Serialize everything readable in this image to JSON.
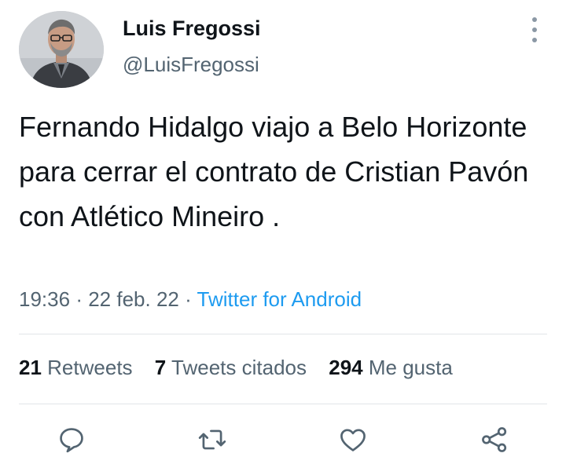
{
  "tweet": {
    "author_name": "Luis Fregossi",
    "author_handle": "@LuisFregossi",
    "text": "Fernando Hidalgo viajo a Belo Horizonte para cerrar el contrato de Cristian Pavón con Atlético Mineiro .",
    "time": "19:36",
    "separator": "·",
    "date": "22 feb. 22",
    "source": "Twitter for Android"
  },
  "stats": {
    "retweets_count": "21",
    "retweets_label": "Retweets",
    "quotes_count": "7",
    "quotes_label": "Tweets citados",
    "likes_count": "294",
    "likes_label": "Me gusta"
  },
  "actions": [
    {
      "name": "reply",
      "icon": "reply-icon"
    },
    {
      "name": "retweet",
      "icon": "retweet-icon"
    },
    {
      "name": "like",
      "icon": "heart-icon"
    },
    {
      "name": "share",
      "icon": "share-icon"
    }
  ],
  "colors": {
    "text_primary": "#0f1419",
    "text_secondary": "#536471",
    "link": "#1d9bf0",
    "divider": "#e1e5e8"
  }
}
